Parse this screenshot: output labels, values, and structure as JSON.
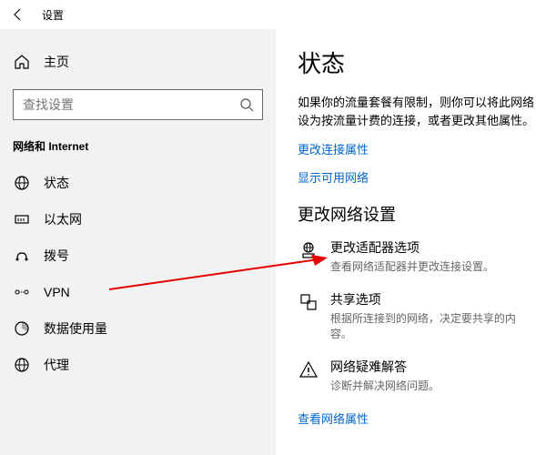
{
  "titlebar": {
    "title": "设置"
  },
  "sidebar": {
    "home": "主页",
    "search_placeholder": "查找设置",
    "category": "网络和 Internet",
    "items": [
      {
        "label": "状态"
      },
      {
        "label": "以太网"
      },
      {
        "label": "拨号"
      },
      {
        "label": "VPN"
      },
      {
        "label": "数据使用量"
      },
      {
        "label": "代理"
      }
    ]
  },
  "content": {
    "heading": "状态",
    "desc": "如果你的流量套餐有限制，则你可以将此网络设为按流量计费的连接，或者更改其他属性。",
    "link_change_conn": "更改连接属性",
    "link_show_net": "显示可用网络",
    "section_heading": "更改网络设置",
    "options": [
      {
        "title": "更改适配器选项",
        "sub": "查看网络适配器并更改连接设置。"
      },
      {
        "title": "共享选项",
        "sub": "根据所连接到的网络，决定要共享的内容。"
      },
      {
        "title": "网络疑难解答",
        "sub": "诊断并解决网络问题。"
      }
    ],
    "link_net_props": "查看网络属性"
  }
}
